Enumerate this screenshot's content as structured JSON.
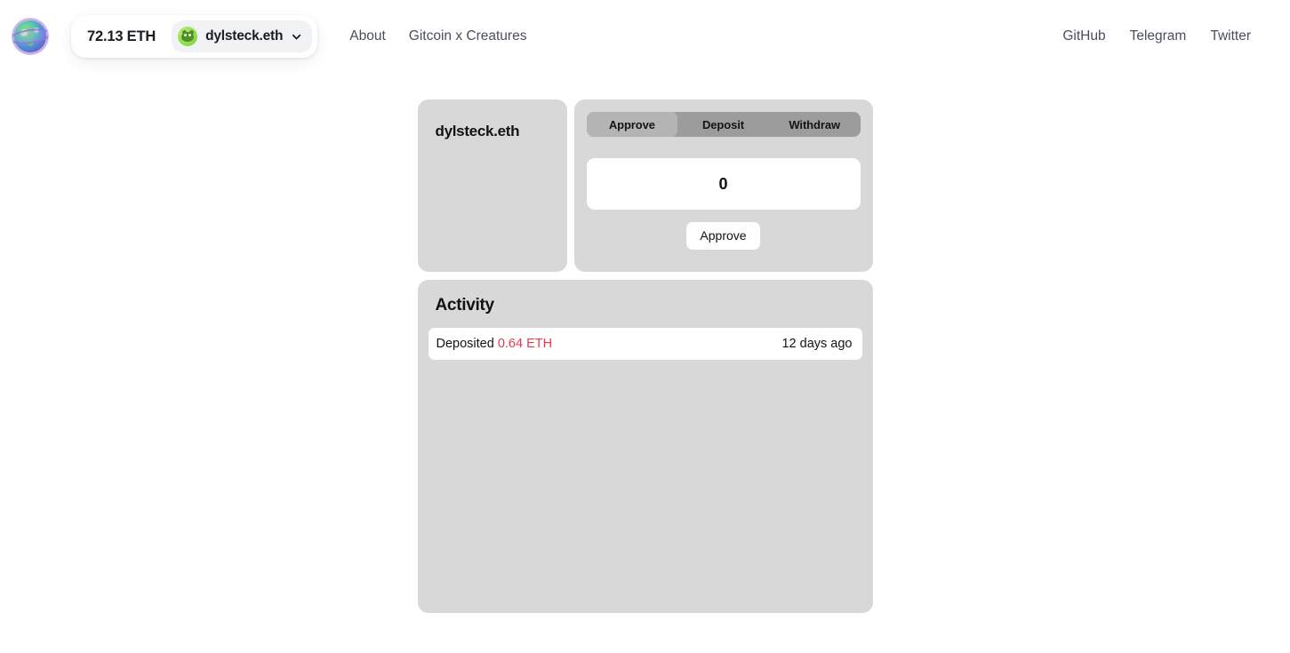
{
  "header": {
    "logo_icon": "globe-logo-icon",
    "wallet": {
      "balance": "72.13 ETH",
      "account_name": "dylsteck.eth",
      "avatar_icon": "creature-avatar-icon",
      "chevron_icon": "chevron-down-icon"
    },
    "nav_left": [
      {
        "label": "About"
      },
      {
        "label": "Gitcoin x Creatures"
      }
    ],
    "nav_right": [
      {
        "label": "GitHub"
      },
      {
        "label": "Telegram"
      },
      {
        "label": "Twitter"
      }
    ]
  },
  "profile": {
    "name": "dylsteck.eth"
  },
  "action_panel": {
    "tabs": [
      {
        "label": "Approve",
        "active": true
      },
      {
        "label": "Deposit",
        "active": false
      },
      {
        "label": "Withdraw",
        "active": false
      }
    ],
    "amount_value": "0",
    "amount_placeholder": "0",
    "submit_label": "Approve"
  },
  "activity": {
    "title": "Activity",
    "items": [
      {
        "action": "Deposited",
        "amount": "0.64 ETH",
        "time": "12 days ago"
      }
    ]
  },
  "colors": {
    "page_background": "#ffffff",
    "card_background": "#d8d8d8",
    "tab_bar": "#9c9c9c",
    "tab_active": "#b4b4b4",
    "amount_red": "#e8384f",
    "nav_text": "#4a5058",
    "avatar_green": "#95dd4f"
  }
}
